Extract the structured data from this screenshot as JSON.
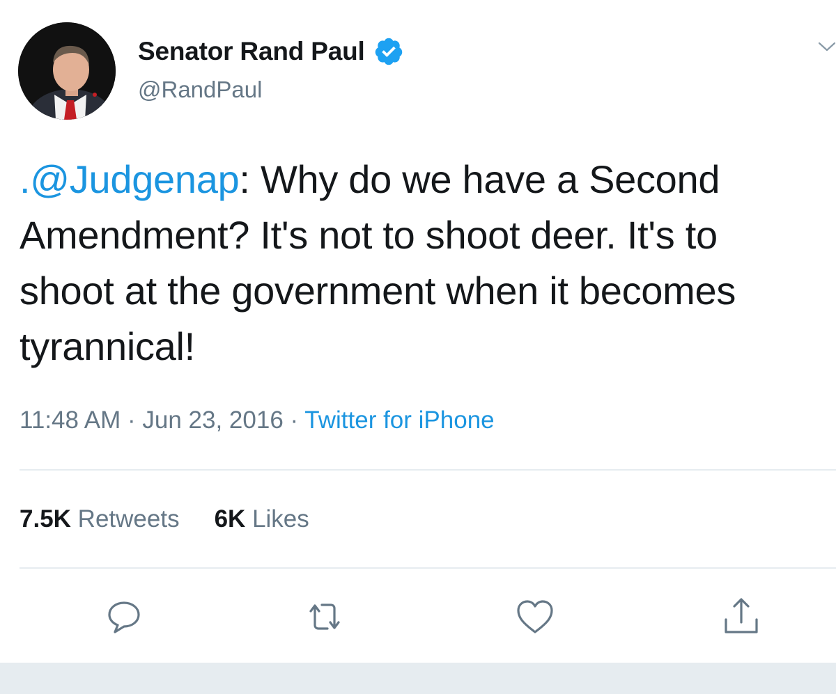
{
  "author": {
    "display_name": "Senator Rand Paul",
    "handle": "@RandPaul",
    "verified": true
  },
  "tweet": {
    "mention": ".@Judgenap",
    "text": ": Why do we have a Second Amendment? It's not to shoot deer. It's to shoot at the government when it becomes tyrannical!"
  },
  "meta": {
    "time": "11:48 AM",
    "separator": " · ",
    "date": "Jun 23, 2016",
    "source": "Twitter for iPhone"
  },
  "stats": {
    "retweets_count": "7.5K",
    "retweets_label": "Retweets",
    "likes_count": "6K",
    "likes_label": "Likes"
  },
  "icons": {
    "more": "chevron-down-icon",
    "reply": "reply-icon",
    "retweet": "retweet-icon",
    "like": "heart-icon",
    "share": "share-icon",
    "verified": "verified-badge-icon"
  },
  "colors": {
    "link": "#1b95e0",
    "verified": "#1da1f2",
    "secondary_text": "#657786",
    "primary_text": "#14171a",
    "divider": "#e6ecf0"
  }
}
